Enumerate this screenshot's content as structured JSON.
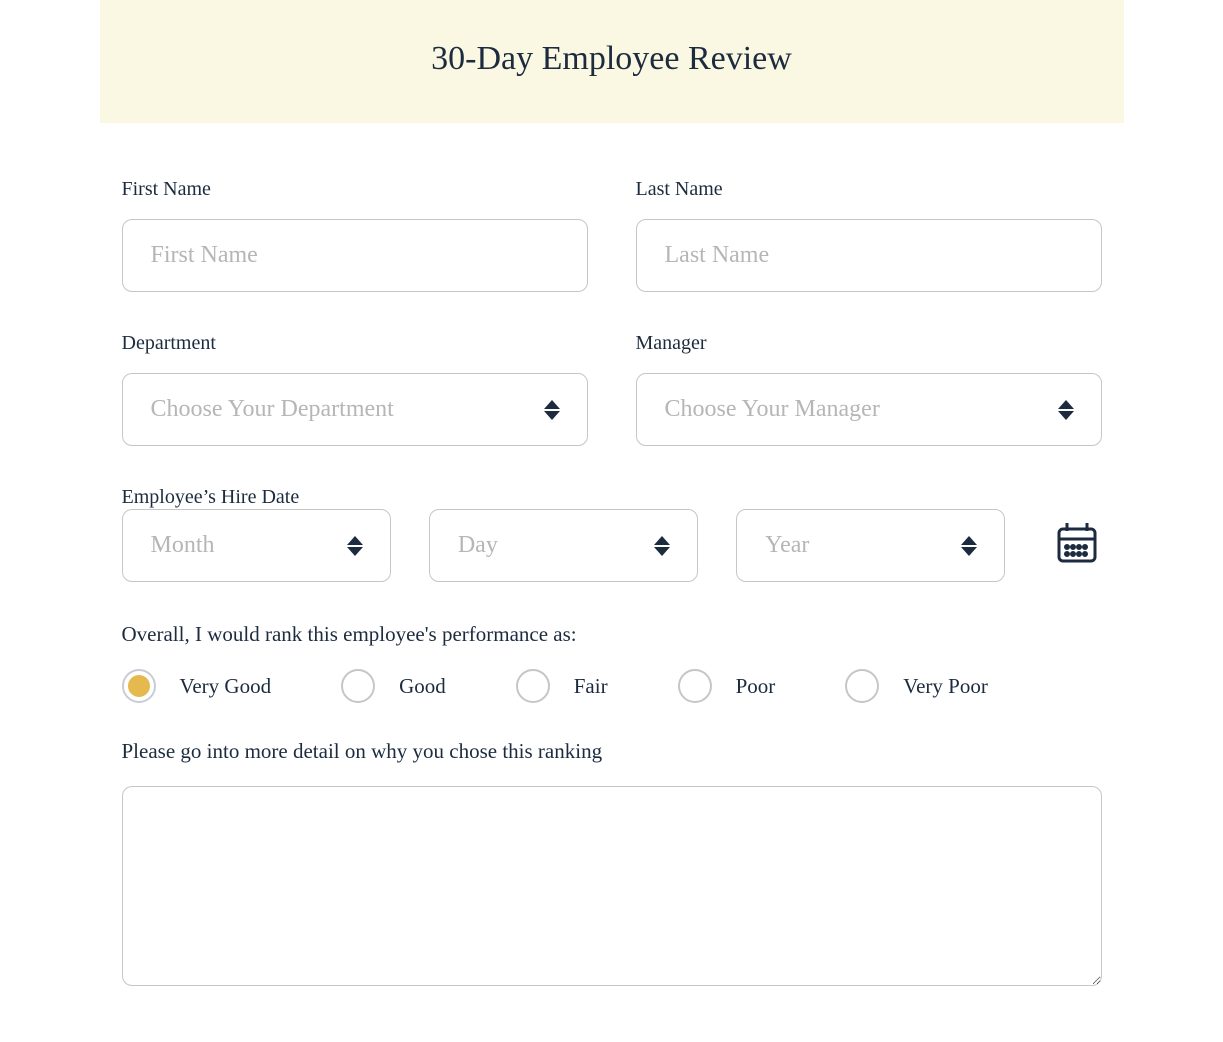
{
  "header": {
    "title": "30-Day Employee Review"
  },
  "firstName": {
    "label": "First Name",
    "placeholder": "First Name",
    "value": ""
  },
  "lastName": {
    "label": "Last Name",
    "placeholder": "Last Name",
    "value": ""
  },
  "department": {
    "label": "Department",
    "placeholder": "Choose Your Department"
  },
  "manager": {
    "label": "Manager",
    "placeholder": "Choose Your Manager"
  },
  "hireDate": {
    "label": "Employee’s Hire Date",
    "month": "Month",
    "day": "Day",
    "year": "Year"
  },
  "performance": {
    "question": "Overall, I would rank this employee's performance as:",
    "options": [
      {
        "label": "Very Good",
        "selected": true
      },
      {
        "label": "Good",
        "selected": false
      },
      {
        "label": "Fair",
        "selected": false
      },
      {
        "label": "Poor",
        "selected": false
      },
      {
        "label": "Very Poor",
        "selected": false
      }
    ]
  },
  "detail": {
    "label": "Please go into more detail on why you chose this ranking",
    "value": ""
  }
}
